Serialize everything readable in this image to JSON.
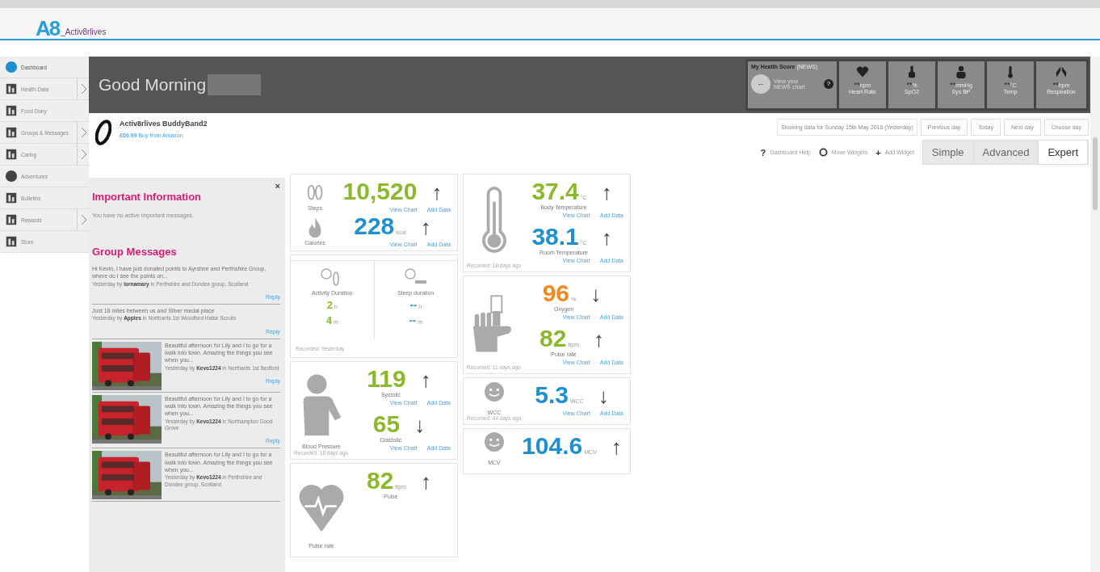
{
  "header": {
    "logo_mark": "A8",
    "logo_text": "_Activ8rlives"
  },
  "sidebar": {
    "items": [
      {
        "label": "Dashboard",
        "selected": true,
        "submenu": false
      },
      {
        "label": "Health Data",
        "selected": false,
        "submenu": true
      },
      {
        "label": "Food Diary",
        "selected": false,
        "submenu": false
      },
      {
        "label": "Groups & Messages",
        "selected": false,
        "submenu": true
      },
      {
        "label": "Caring",
        "selected": false,
        "submenu": true
      },
      {
        "label": "Adventures",
        "selected": false,
        "submenu": false
      },
      {
        "label": "Bulletins",
        "selected": false,
        "submenu": false
      },
      {
        "label": "Rewards",
        "selected": false,
        "submenu": true
      },
      {
        "label": "Store",
        "selected": false,
        "submenu": false
      }
    ]
  },
  "greeting": "Good Morning",
  "health_score": {
    "title": "My Health Score",
    "tag": "(NEWS)",
    "score": "--",
    "link": "View your NEWS chart",
    "help": "?",
    "tiles": [
      {
        "value": "**",
        "unit": "bpm",
        "label": "Heart Rate"
      },
      {
        "value": "**",
        "unit": "%",
        "label": "SpO2"
      },
      {
        "value": "**",
        "unit": "mmHg",
        "label": "Sys BP"
      },
      {
        "value": "**",
        "unit": "°C",
        "label": "Temp"
      },
      {
        "value": "**",
        "unit": "bpm",
        "label": "Respiration"
      }
    ]
  },
  "product": {
    "name": "Activ8rlives BuddyBand2",
    "price": "£69.99",
    "link": "Buy from Amazon"
  },
  "date_bar": {
    "showing": "Showing data for Sunday 15th May 2016 (Yesterday)",
    "buttons": [
      "Previous day",
      "Today",
      "Next day",
      "Choose day"
    ]
  },
  "tools": [
    {
      "icon": "?",
      "label": "Dashboard Help"
    },
    {
      "label": "Move Widgets"
    },
    {
      "icon": "+",
      "label": "Add Widget"
    }
  ],
  "modes": [
    {
      "label": "Simple",
      "selected": false
    },
    {
      "label": "Advanced",
      "selected": false
    },
    {
      "label": "Expert",
      "selected": true
    }
  ],
  "info_panel": {
    "close": "×",
    "important_title": "Important Information",
    "important_text": "You have no active important messages.",
    "messages_title": "Group Messages",
    "messages": [
      {
        "kind": "text",
        "text": "Hi Kevin, I have just donated points to Ayrshire and Perthshire Group, where do I see the points on...",
        "meta": "Yesterday by **lornamary** in Perthshire and Dundee group, Scotland",
        "reply": "Reply"
      },
      {
        "kind": "text",
        "text": "Just 18 miles between us and Silver medal place",
        "meta": "Yesterday by **Apples** in Northants 1st Woodford Halse Scouts",
        "reply": "Reply"
      },
      {
        "text": "Beautiful afternoon for Lily and I to go for a walk into town. Amazing the things you see when you...",
        "meta": "Yesterday by **Kevo1224** in Northants 1st Bedford",
        "reply": "Reply"
      },
      {
        "text": "Beautiful afternoon for Lily and I to go for a walk into town. Amazing the things you see when you...",
        "meta": "Yesterday by **Kevo1224** in Northampton Good Grove",
        "reply": "Reply"
      },
      {
        "text": "Beautiful afternoon for Lily and I to go for a walk into town. Amazing the things you see when you...",
        "meta": "Yesterday by **Kevo1224** in Perthshire and Dundee group, Scotland"
      }
    ]
  },
  "widgets": {
    "columns": [
      [
        {
          "kind": "paired",
          "metrics": [
            {
              "caption": "Steps",
              "value": "10,520",
              "color": "#8cb82b",
              "trend": "↑",
              "view": "View Chart",
              "add": "Add Data"
            },
            {
              "caption": "Calories",
              "value": "228",
              "unit": "kcal",
              "color": "#1e8fd0",
              "trend": "↑",
              "view": "View Chart",
              "add": "Add Data"
            }
          ]
        },
        {
          "kind": "duration",
          "recorded": "Recorded: Yesterday",
          "halves": [
            {
              "label": "Activity Duration",
              "hours": "2",
              "hours_unit": "h",
              "minutes": "4",
              "minutes_unit": "m",
              "color": "#8cb82b"
            },
            {
              "label": "Sleep duration",
              "hours": "--",
              "hours_unit": "h",
              "minutes": "--",
              "minutes_unit": "m",
              "color": "#1e8fd0"
            }
          ]
        },
        {
          "kind": "single",
          "caption": "Blood Pressure",
          "recorded": "Recorded: 18 days ago",
          "metrics": [
            {
              "value": "119",
              "color": "#8cb82b",
              "trend": "↑",
              "label": "Systolic",
              "view": "View Chart",
              "add": "Add Data"
            },
            {
              "value": "65",
              "color": "#8cb82b",
              "trend": "↓",
              "label": "Diastolic",
              "view": "View Chart",
              "add": "Add Data"
            }
          ]
        },
        {
          "kind": "single",
          "caption": "Pulse rate",
          "metrics": [
            {
              "value": "82",
              "unit": "bpm",
              "color": "#8cb82b",
              "trend": "↑",
              "label": "Pulse"
            }
          ]
        }
      ],
      [
        {
          "kind": "single",
          "recorded": "Recorded: 18 days ago",
          "metrics": [
            {
              "value": "37.4",
              "unit": "°C",
              "color": "#8cb82b",
              "trend": "↑",
              "label": "Body Temperature",
              "view": "View Chart",
              "add": "Add Data"
            },
            {
              "value": "38.1",
              "unit": "°C",
              "color": "#1e8fd0",
              "trend": "↑",
              "label": "Room Temperature",
              "view": "View Chart",
              "add": "Add Data"
            }
          ]
        },
        {
          "kind": "single",
          "recorded": "Recorded: 11 days ago",
          "metrics": [
            {
              "value": "96",
              "unit": "%",
              "color": "#f08a24",
              "trend": "↓",
              "label": "Oxygen",
              "view": "View Chart",
              "add": "Add Data"
            },
            {
              "value": "82",
              "unit": "bpm",
              "color": "#8cb82b",
              "trend": "↑",
              "label": "Pulse rate",
              "view": "View Chart",
              "add": "Add Data"
            }
          ]
        },
        {
          "kind": "single",
          "caption": "WCC",
          "recorded": "Recorded: 44 days ago",
          "metrics": [
            {
              "value": "5.3",
              "unit": "WCC",
              "color": "#1e8fd0",
              "trend": "↓",
              "view": "View Chart",
              "add": "Add Data"
            }
          ]
        },
        {
          "kind": "single",
          "caption": "MCV",
          "metrics": [
            {
              "value": "104.6",
              "unit": "MCV",
              "color": "#1e8fd0",
              "trend": "↑"
            }
          ]
        }
      ]
    ]
  }
}
